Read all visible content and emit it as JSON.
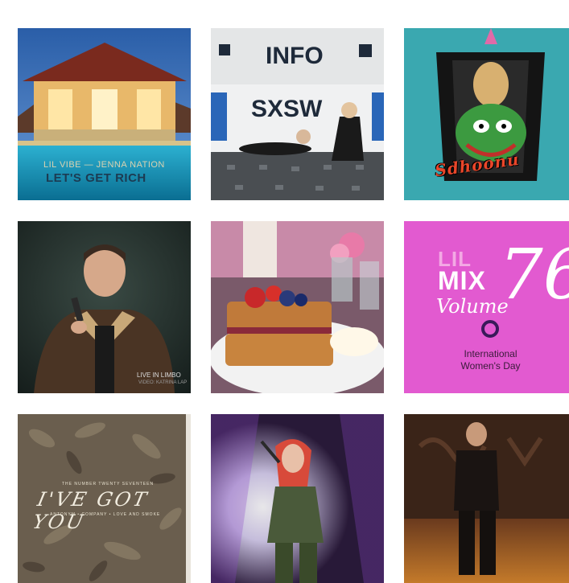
{
  "gallery": {
    "tiles": [
      {
        "id": "t1",
        "artists": "LIL VIBE — JENNA NATION",
        "title_part1": "LET'S GET ",
        "title_part2": "RICH"
      },
      {
        "id": "t2",
        "sign_top": "INFO",
        "sign_main": "SXSW"
      },
      {
        "id": "t3",
        "word": "Sdhoonu"
      },
      {
        "id": "t4",
        "caption": "LIVE IN LIMBO",
        "subcaption": "VIDEO: KATRINA LAP"
      },
      {
        "id": "t5"
      },
      {
        "id": "t6",
        "lil": "LIL",
        "mix": "MIX",
        "volume": "Volume",
        "number": "76",
        "caption_line1": "International",
        "caption_line2": "Women's Day"
      },
      {
        "id": "t7",
        "artist": "THE NUMBER TWENTY SEVENTEEN",
        "title": "I'VE GOT YOU",
        "subtitle": "ANTONYM • COMPANY • LOVE AND SMOKE"
      },
      {
        "id": "t8"
      },
      {
        "id": "t9"
      }
    ]
  }
}
